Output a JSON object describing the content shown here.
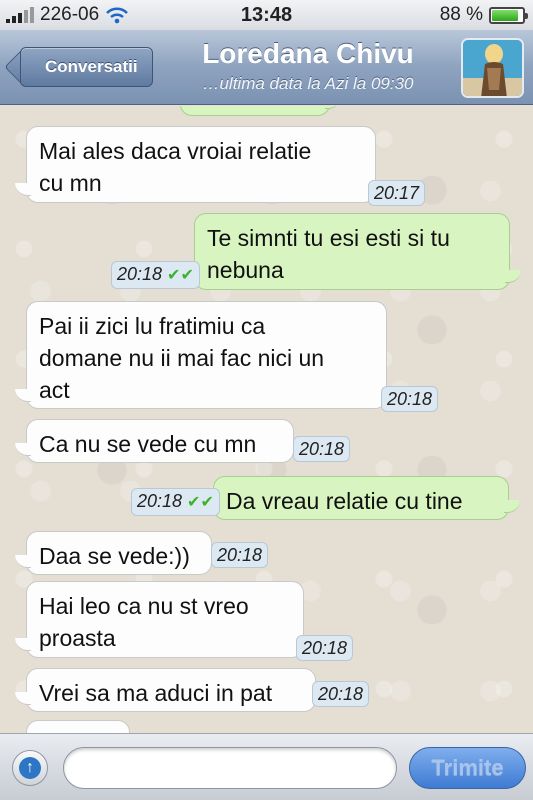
{
  "status_bar": {
    "carrier": "226-06",
    "time": "13:48",
    "battery": "88 %",
    "battery_level": 0.88
  },
  "nav": {
    "back_label": "Conversatii",
    "contact_name": "Loredana Chivu",
    "last_seen": "…ultima data la Azi la 09:30"
  },
  "messages": [
    {
      "direction": "in",
      "text_lines": [
        "Mai ales daca vroiai relatie",
        "cu mn"
      ],
      "time": "20:17"
    },
    {
      "direction": "out",
      "text_lines": [
        "Te simnti tu esi esti si tu",
        "nebuna"
      ],
      "time": "20:18",
      "status": "double-check"
    },
    {
      "direction": "in",
      "text_lines": [
        "Pai ii zici lu fratimiu ca",
        "domane nu ii mai fac nici un",
        "act"
      ],
      "time": "20:18"
    },
    {
      "direction": "in",
      "text_lines": [
        "Ca nu se vede cu mn"
      ],
      "time": "20:18"
    },
    {
      "direction": "out",
      "text_lines": [
        "Da vreau relatie cu tine"
      ],
      "time": "20:18",
      "status": "double-check"
    },
    {
      "direction": "in",
      "text_lines": [
        "Daa se vede:))"
      ],
      "time": "20:18"
    },
    {
      "direction": "in",
      "text_lines": [
        "Hai leo ca nu st vreo",
        "proasta"
      ],
      "time": "20:18"
    },
    {
      "direction": "in",
      "text_lines": [
        "Vrei sa ma aduci in pat"
      ],
      "time": "20:18"
    }
  ],
  "composer": {
    "input_value": "",
    "send_label": "Trimite"
  },
  "icons": {
    "attach": "arrow-up-icon",
    "check": "✔✔"
  }
}
